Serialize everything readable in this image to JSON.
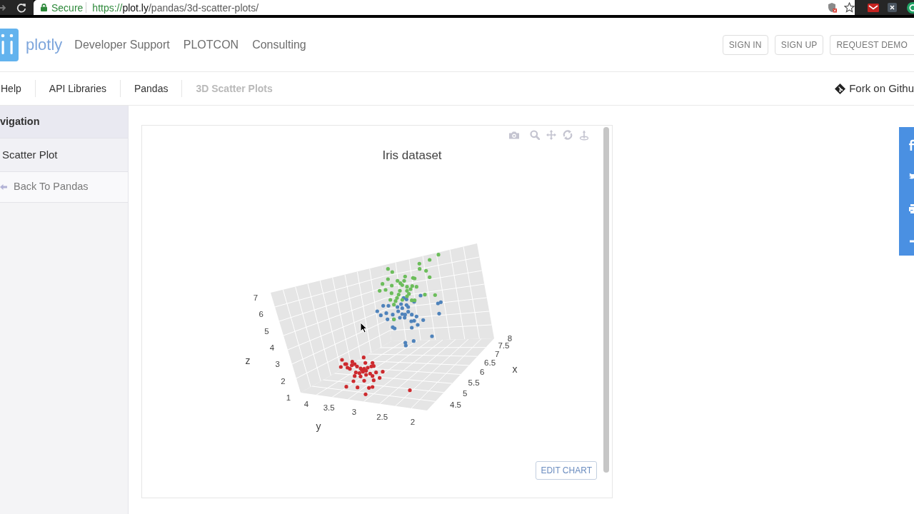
{
  "browser": {
    "security_label": "Secure",
    "url": {
      "scheme": "https://",
      "host": "plot.ly",
      "path": "/pandas/3d-scatter-plots/"
    }
  },
  "header": {
    "logo_text": "plotly",
    "nav_links": [
      "Developer Support",
      "PLOTCON",
      "Consulting"
    ],
    "buttons": [
      "SIGN IN",
      "SIGN UP",
      "REQUEST DEMO"
    ]
  },
  "breadcrumb": {
    "items": [
      {
        "label": "Help",
        "current": false
      },
      {
        "label": "API Libraries",
        "current": false
      },
      {
        "label": "Pandas",
        "current": false
      },
      {
        "label": "3D Scatter Plots",
        "current": true
      }
    ],
    "fork_link": "Fork on Githu"
  },
  "sidebar": {
    "heading": "vigation",
    "items": [
      {
        "kind": "page",
        "label": "Scatter Plot"
      },
      {
        "kind": "back",
        "label": "Back To Pandas"
      }
    ]
  },
  "chart": {
    "title": "Iris dataset",
    "scene": {
      "z_axis": {
        "title": "z",
        "ticks": [
          "7",
          "6",
          "5",
          "4",
          "3",
          "2",
          "1"
        ]
      },
      "x_axis": {
        "title": "x",
        "ticks": [
          "8",
          "7.5",
          "7",
          "6.5",
          "6",
          "5.5",
          "5",
          "4.5"
        ]
      },
      "y_axis": {
        "title": "y",
        "ticks": [
          "4",
          "3.5",
          "3",
          "2.5",
          "2"
        ]
      }
    },
    "point_groups": [
      {
        "color": "#cd2a2e"
      },
      {
        "color": "#4f83bb"
      },
      {
        "color": "#6cbd5b"
      }
    ],
    "edit_button": "EDIT CHART"
  }
}
